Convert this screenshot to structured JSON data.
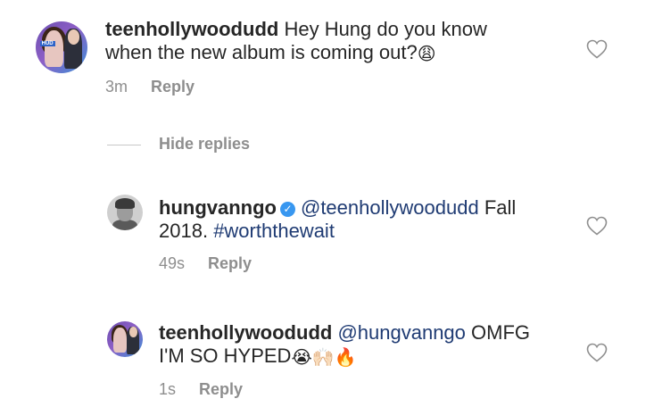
{
  "comments": [
    {
      "username": "teenhollywoodudd",
      "text_line1": "Hey Hung do you know",
      "text_line2": "when the new album is coming out?",
      "emoji": "😩",
      "time": "3m",
      "reply_label": "Reply",
      "avatar_badge": "HUD"
    },
    {
      "username": "hungvanngo",
      "verified_glyph": "✓",
      "mention": "@teenhollywoodudd",
      "text_line1_after": "Fall",
      "text_line2_prefix": "2018.",
      "hashtag": "#worththewait",
      "time": "49s",
      "reply_label": "Reply"
    },
    {
      "username": "teenhollywoodudd",
      "mention": "@hungvanngo",
      "text_line1_after": "OMFG",
      "text_line2": "I'M SO HYPED",
      "emojis": "😭🙌🏻🔥",
      "time": "1s",
      "reply_label": "Reply"
    }
  ],
  "hide_replies_label": "Hide replies",
  "icons": {
    "like": "heart-outline-icon",
    "verified": "verified-badge-icon"
  },
  "colors": {
    "text": "#262626",
    "muted": "#8e8e8e",
    "link": "#1f3b73",
    "verified": "#3897f0"
  }
}
